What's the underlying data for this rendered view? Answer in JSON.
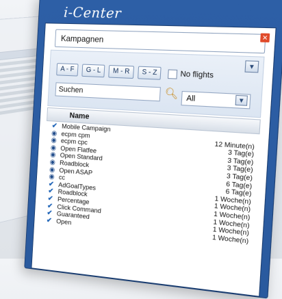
{
  "window": {
    "title": "i-Center"
  },
  "campaign_select": {
    "value": "Kampagnen"
  },
  "filter": {
    "buttons": [
      "A - F",
      "G - L",
      "M - R",
      "S - Z"
    ],
    "no_flights_label": "No flights",
    "search_placeholder": "Suchen",
    "scope_value": "All"
  },
  "list": {
    "header_name": "Name",
    "rows": [
      {
        "icon": "check",
        "name": "Mobile Campaign",
        "time": ""
      },
      {
        "icon": "ball",
        "name": "ecpm cpm",
        "time": "12 Minute(n)"
      },
      {
        "icon": "ball",
        "name": "ecpm cpc",
        "time": "3 Tag(e)"
      },
      {
        "icon": "ball",
        "name": "Open Flatfee",
        "time": "3 Tag(e)"
      },
      {
        "icon": "ball",
        "name": "Open Standard",
        "time": "3 Tag(e)"
      },
      {
        "icon": "ball",
        "name": "Roadblock",
        "time": "3 Tag(e)"
      },
      {
        "icon": "ball",
        "name": "Open ASAP",
        "time": "6 Tag(e)"
      },
      {
        "icon": "ball",
        "name": "cc",
        "time": "6 Tag(e)"
      },
      {
        "icon": "check",
        "name": "AdGoalTypes",
        "time": "1 Woche(n)"
      },
      {
        "icon": "check",
        "name": "Roadblock",
        "time": "1 Woche(n)"
      },
      {
        "icon": "check",
        "name": "Percentage",
        "time": "1 Woche(n)"
      },
      {
        "icon": "check",
        "name": "Click Command",
        "time": "1 Woche(n)"
      },
      {
        "icon": "check",
        "name": "Guaranteed",
        "time": "1 Woche(n)"
      },
      {
        "icon": "check",
        "name": "Open",
        "time": "1 Woche(n)"
      }
    ]
  },
  "colors": {
    "frame": "#2d5fa6",
    "accent": "#2266b8",
    "close": "#e04a2a"
  }
}
